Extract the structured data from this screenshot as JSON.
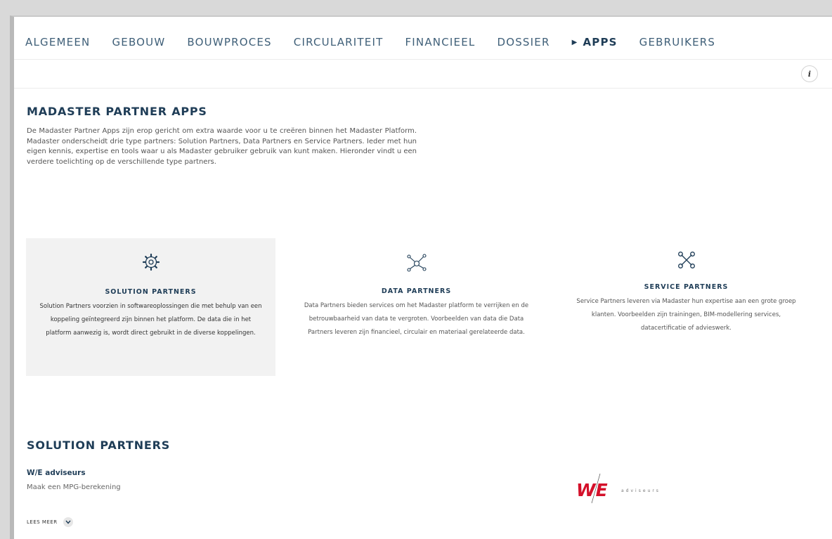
{
  "tabs": [
    {
      "label": "ALGEMEEN"
    },
    {
      "label": "GEBOUW"
    },
    {
      "label": "BOUWPROCES"
    },
    {
      "label": "CIRCULARITEIT"
    },
    {
      "label": "FINANCIEEL"
    },
    {
      "label": "DOSSIER"
    },
    {
      "label": "APPS",
      "active": true
    },
    {
      "label": "GEBRUIKERS"
    }
  ],
  "info_label": "i",
  "page": {
    "title": "MADASTER PARTNER APPS",
    "intro": "De Madaster Partner Apps zijn erop gericht om extra waarde voor u te creëren binnen het Madaster Platform. Madaster onderscheidt drie type partners: Solution Partners, Data Partners en Service Partners. Ieder met hun eigen kennis, expertise en tools waar u als Madaster gebruiker gebruik van kunt maken. Hieronder vindt u een verdere toelichting op de verschillende type partners."
  },
  "cards": [
    {
      "icon": "gear-icon",
      "title": "SOLUTION PARTNERS",
      "text": "Solution Partners voorzien in softwareoplossingen die met behulp van een koppeling geïntegreerd zijn binnen het platform. De data die in het platform aanwezig is, wordt direct gebruikt in de diverse koppelingen."
    },
    {
      "icon": "network-icon",
      "title": "DATA PARTNERS",
      "text": "Data Partners bieden services om het Madaster platform te verrijken en de betrouwbaarheid van data te vergroten. Voorbeelden van data die Data Partners leveren zijn financieel, circulair en materiaal gerelateerde data."
    },
    {
      "icon": "tools-icon",
      "title": "SERVICE PARTNERS",
      "text": "Service Partners leveren via Madaster hun expertise aan een grote groep klanten. Voorbeelden zijn trainingen, BIM-modellering services, datacertificatie of advieswerk."
    }
  ],
  "solution_section": {
    "title": "SOLUTION PARTNERS",
    "partners": [
      {
        "name": "W/E adviseurs",
        "description": "Maak een MPG-berekening",
        "more_label": "LEES MEER",
        "logo_mark": "WE",
        "logo_text": "adviseurs"
      }
    ]
  },
  "colors": {
    "navy": "#1f3d57",
    "tab_text": "#3f5f78",
    "logo_red": "#d4102a",
    "card_bg": "#f2f2f2"
  }
}
